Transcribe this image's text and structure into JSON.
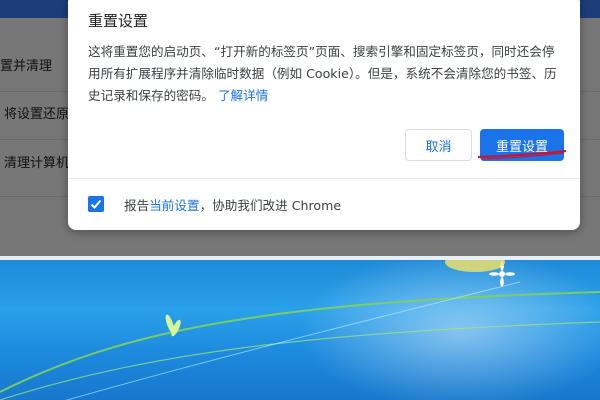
{
  "settings": {
    "items": [
      {
        "label": "置并清理"
      },
      {
        "label": "将设置还原"
      },
      {
        "label": "清理计算机"
      }
    ]
  },
  "dialog": {
    "title": "重置设置",
    "body": "这将重置您的启动页、“打开新的标签页”页面、搜索引擎和固定标签页，同时还会停用所有扩展程序并清除临时数据（例如 Cookie）。但是，系统不会清除您的书签、历史记录和保存的密码。",
    "learn_more": "了解详情",
    "cancel_label": "取消",
    "reset_label": "重置设置",
    "report": {
      "checked": true,
      "prefix": "报告",
      "link": "当前设置",
      "suffix": "，协助我们改进 Chrome"
    }
  },
  "colors": {
    "accent": "#1a73e8",
    "annotation": "#d0112b"
  }
}
